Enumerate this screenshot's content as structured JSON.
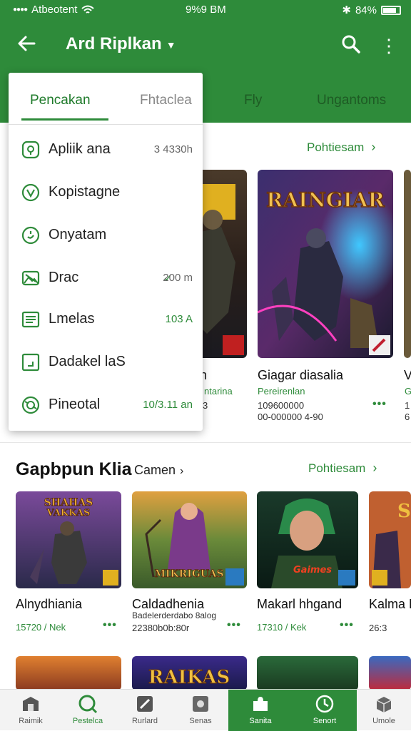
{
  "status_bar": {
    "carrier": "Atbeotent",
    "time": "9%9 BM",
    "battery": "84%",
    "colors": {
      "bg": "#2e8b3a"
    }
  },
  "app_bar": {
    "title": "Ard Riplkan",
    "icons": [
      "back-arrow-icon",
      "chevron-down-icon",
      "search-icon",
      "more-vert-icon"
    ]
  },
  "tabs": [
    "Fly",
    "Ungantoms"
  ],
  "menu": {
    "tabs": [
      "Pencakan",
      "Fhtaclea"
    ],
    "items": [
      {
        "label": "Apliik ana",
        "value": "3 4330h",
        "icon": "shield-icon"
      },
      {
        "label": "Kopistagne",
        "value": "",
        "icon": "check-circle-icon"
      },
      {
        "label": "Onyatam",
        "value": "",
        "icon": "chat-icon"
      },
      {
        "label": "Drac",
        "value": "200 m",
        "check": "✓",
        "icon": "image-icon"
      },
      {
        "label": "Lmelas",
        "value": "103 A",
        "icon": "list-icon"
      },
      {
        "label": "Dadakel laS",
        "value": "",
        "icon": "square-icon"
      },
      {
        "label": "Pineotal",
        "value": "10/3.11 an",
        "icon": "badge-icon"
      }
    ]
  },
  "section1": {
    "link": "Pohtiesam",
    "cards": [
      {
        "title": "n",
        "sub": "ntarina",
        "meta": "3"
      },
      {
        "title": "Giagar diasalia",
        "sub": "Pereirenlan",
        "meta": "109600000",
        "meta2": "00-000000 4-90",
        "art_text": "RAINGIAR"
      },
      {
        "title": "V",
        "sub": "G",
        "meta": "1",
        "meta2": "6"
      }
    ]
  },
  "section2": {
    "title": "Gapbpun Klia",
    "subtitle": "Camen",
    "link": "Pohtiesam",
    "cards": [
      {
        "title": "Alnydhiania",
        "meta": "15720 / Nek",
        "art_text": "SHAHAS\nVAKKAS"
      },
      {
        "title": "Caldadhenia",
        "sub": "Badelerderdabo 8alog",
        "meta": "22380b0b:80r",
        "art_text": "MIKRIGUAS"
      },
      {
        "title": "Makarl hhgand",
        "meta": "17310 / Kek",
        "art_text": "Gaimes"
      },
      {
        "title": "Kalma L",
        "meta": "26:3"
      }
    ],
    "row3_art": [
      "",
      "RAIKAS",
      "",
      ""
    ]
  },
  "bottom_nav": [
    {
      "label": "Raimik",
      "icon": "store-icon"
    },
    {
      "label": "Pestelca",
      "icon": "search-icon"
    },
    {
      "label": "Rurlard",
      "icon": "game-icon"
    },
    {
      "label": "Senas",
      "icon": "apps-icon"
    },
    {
      "label": "Sanita",
      "icon": "puzzle-icon"
    },
    {
      "label": "Senort",
      "icon": "clock-icon"
    },
    {
      "label": "Umole",
      "icon": "box-icon"
    }
  ],
  "colors": {
    "accent": "#2e8b3a",
    "accent_dark": "#1e5b24"
  }
}
